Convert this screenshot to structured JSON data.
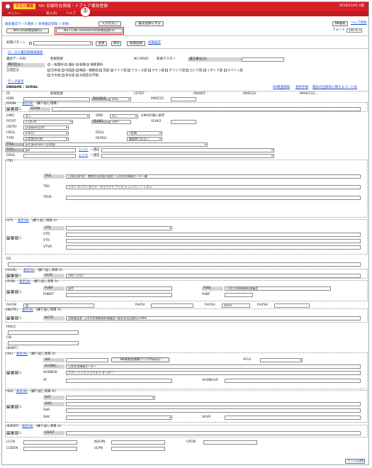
{
  "titlebar": {
    "tag": "テスト環境",
    "title": "NII 目録所在情報・ナアトア書誌登録",
    "date": "2019/11/01 A版"
  },
  "menu": {
    "item1": "メニュー",
    "item2": "受入(R)",
    "item3": "ヘルプ"
  },
  "badge": "①",
  "breadcrumb": "検索書誌データ選択 > 新規書誌登録 > 新規...",
  "toolbar": {
    "btn_input": "入力を完了",
    "btn_clear": "書誌登録にする",
    "btn_nii": "NII検索",
    "link_help": "ヘルプ参照",
    "font_label": "フォント",
    "font_value": "100 %"
  },
  "tabs": {
    "tab1": "NACSIS新規登録(S)",
    "tab2": "NII＋CiNii Researchの新規登録(X)"
  },
  "pattern": {
    "label": "初期パターン",
    "select": "",
    "btn_change": "変更",
    "btn_save": "保存",
    "btn_default": "新規登録",
    "link": "初期設定"
  },
  "links": {
    "local_search": "ローカル書誌情報再検索",
    "data_display": "データ表示",
    "related_info": "NII関連情報",
    "update_history": "更新手順",
    "other_codes": "雑誌の出版等に関するコード表"
  },
  "info": {
    "cat_label": "書誌データID",
    "cat_value": "新規登録",
    "ncmarc": "NC-MARC",
    "ncmarc_val": "新規マスター",
    "record_label": "書誌番号(O)",
    "record_value": "",
    "type_label": "資料区分 I",
    "type_options": [
      "一般資料",
      "雑誌",
      "新聞",
      "特殊資料"
    ],
    "lang_label": "言語区分",
    "languages": [
      "日本語",
      "中国語",
      "韓国・朝鮮語",
      "英語",
      "ドイツ語",
      "フランス語",
      "ラテン語",
      "ギリシア語",
      "ロシア語",
      "イタリア語",
      "スペイン語",
      "その他",
      "多言語",
      "言語区分不明"
    ]
  },
  "db": {
    "name": "DBNAME : SERIAL",
    "id_label": "ID",
    "id_val": "新規登録",
    "crtdt": "CRTDT :",
    "rnwdt": "RNWDT :",
    "marcid": "MARCID :",
    "marcflg": "MARCFLG :"
  },
  "fields": [
    {
      "k": "ISSN",
      "v": ""
    },
    {
      "k": "SOURCE",
      "v": "ORG"
    },
    {
      "k": "MARCID",
      "v": ""
    }
  ],
  "xissn": {
    "label": "XISSN",
    "link": "表示(N)",
    "repeat": "(繰り返し項目)",
    "sub": "XISSN"
  },
  "gmd": {
    "label": "GMD",
    "val": "なし",
    "smd": "SMD",
    "smd_val": "なし",
    "note": "GMDの値に依存"
  },
  "pstat": {
    "label": "PSTAT",
    "val": "c:刊行中",
    "year1": "YEAR1",
    "year1_val": "1997",
    "year2": "YEAR2",
    "year2_val": ""
  },
  "cntry": {
    "label": "CNTRY",
    "val": "ja:Japan(日本)"
  },
  "freq": {
    "label": "FREQ",
    "val": "a:年刊",
    "regl": "REGL",
    "regl_val": "r:定期"
  },
  "type": {
    "label": "TYPE",
    "val": "p:定期刊行物",
    "repro": "REPRO",
    "repro_val": "複製物ではない"
  },
  "ttll": {
    "label": "TTLL",
    "val": "jpn:Japanese (日本語)"
  },
  "txtl": {
    "label": "TXTL",
    "val": "jpn",
    "link": "レベル",
    "add": "一連記"
  },
  "orgl": {
    "label": "ORGL",
    "val": "",
    "link": "レベル",
    "add": "一連記"
  },
  "tr": {
    "label": "(TR)",
    "trd": "TRD",
    "trd_val": "日本近現代史・教育文化出版の歴史 / 日本文化情報センター編",
    "trr": "TRR",
    "trr_val": "ニホン キンゲンダイシ・キョウイク ブンカ シュッパン ノ レキシ",
    "trvr": "TRVR",
    "trvr_val": ""
  },
  "vt": {
    "label": "(VT)",
    "link": "表示(N)",
    "repeat": "(繰り返し項目 A)",
    "vtk": "VTK",
    "vtd": "VTD",
    "vtr": "VTR",
    "vtvr": "VTVR"
  },
  "ed": {
    "label": "ED",
    "val": ""
  },
  "vlyr": {
    "label": "(VLYR)",
    "link": "表示(N)",
    "repeat": "(繰り返し項目 A)",
    "sub": "VLYR",
    "val": "1997 (1号)-"
  },
  "pub": {
    "label": "(PUB)",
    "link": "表示(N)",
    "repeat": "(繰り返し項目 A)",
    "pubp": "PUBP",
    "pubp_val": "東京",
    "publ": "PUBL",
    "publ_val": "日本文化情報資料協議会",
    "pubdt": "PUBDT",
    "pubdt_val": "",
    "pubf": "PUBF",
    "pubf_val": ""
  },
  "phys": {
    "physp": "PHYSP",
    "physp_val": "冊",
    "physi": "PHYSI",
    "physi_val": "",
    "physs": "PHYSS",
    "physs_val": "26cm",
    "physa": "PHYSA"
  },
  "note": {
    "label": "(NOTE)",
    "link": "表示(N)",
    "repeat": "(繰り返し項目 A)",
    "sub": "NOTE",
    "val": "出版者変更: 日本文化情報資料協議会→歴史文化出版社(1999)"
  },
  "price": {
    "label": "PRICE",
    "val": ""
  },
  "fid": {
    "label": "FID",
    "val": ""
  },
  "bhnt": {
    "label": "(BHNT)"
  },
  "al": {
    "label": "(AL)",
    "link": "表示(N)",
    "repeat": "(繰り返し項目 A)",
    "aid": "AID",
    "btn": "NII著者名典拠リンク作成(L)",
    "aflg": "AFLG",
    "ahdng": "AHDNG",
    "ahdng_val": "日本文化情報センター",
    "ahdngr": "AHDNGR",
    "ahdngr_val": "ニホン ブンカ ジョウホウ センター",
    "af": "AF",
    "ahdngvr": "AHDNGVR"
  },
  "sh": {
    "label": "(SH)",
    "link": "表示(N)",
    "repeat": "(繰り返し項目 A)",
    "sht": "SHT",
    "shd": "SHD",
    "shr": "SHR",
    "shk": "SHK",
    "shvr": "SHVR"
  },
  "ident": {
    "label": "(IDENT)",
    "link": "表示(N)",
    "repeat": "(繰り返し項目 A)",
    "sub": "IDENT"
  },
  "bottom": {
    "lccn": "LCCN",
    "ndlpn": "NDLPN",
    "gpon": "GPON",
    "coden": "CODEN",
    "ulpn": "ULPN"
  },
  "page_top": "ページ先頭へ"
}
